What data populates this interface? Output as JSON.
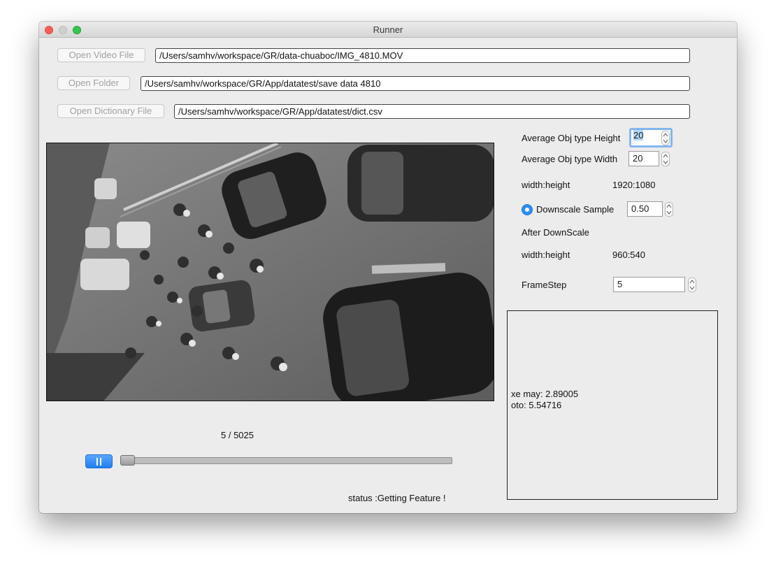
{
  "window": {
    "title": "Runner"
  },
  "files": {
    "video_button": "Open Video File",
    "video_path": "/Users/samhv/workspace/GR/data-chuaboc/IMG_4810.MOV",
    "folder_button": "Open Folder",
    "folder_path": "/Users/samhv/workspace/GR/App/datatest/save data 4810",
    "dict_button": "Open Dictionary File",
    "dict_path": "/Users/samhv/workspace/GR/App/datatest/dict.csv"
  },
  "settings": {
    "avg_height_label": "Average Obj type Height",
    "avg_height_value": "20",
    "avg_width_label": "Average Obj type Width",
    "avg_width_value": "20",
    "wh_label": "width:height",
    "wh_value": "1920:1080",
    "downscale_label": "Downscale Sample",
    "downscale_value": "0.50",
    "after_downscale_label": "After DownScale",
    "after_wh_label": "width:height",
    "after_wh_value": "960:540",
    "framestep_label": "FrameStep",
    "framestep_value": "5"
  },
  "output": {
    "lines": [
      "xe may: 2.89005",
      "oto: 5.54716"
    ]
  },
  "playback": {
    "frame_counter": "5 / 5025",
    "progress_fraction": 0.001,
    "status": "status :Getting Feature !"
  },
  "icons": {
    "play_pause": "pause-icon",
    "stepper": "stepper-icon"
  }
}
